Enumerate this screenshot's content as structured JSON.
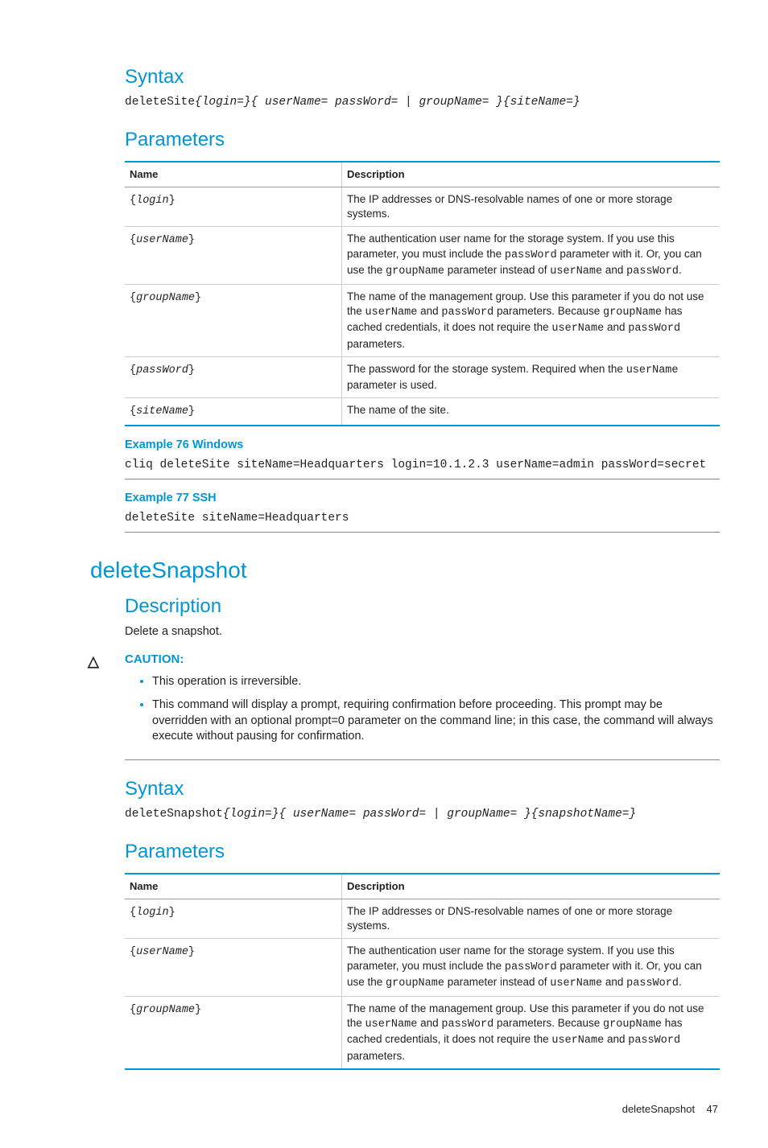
{
  "section1": {
    "syntax_heading": "Syntax",
    "syntax_cmd": "deleteSite",
    "syntax_parts": "{login=}{ userName= passWord= | groupName= }{siteName=}",
    "params_heading": "Parameters",
    "table": {
      "col_name": "Name",
      "col_desc": "Description",
      "rows": [
        {
          "name": "{login}",
          "desc": "The IP addresses or DNS-resolvable names of one or more storage systems."
        },
        {
          "name": "{userName}",
          "desc_pre": "The authentication user name for the storage system. If you use this parameter, you must include the ",
          "c1": "passWord",
          "desc_mid1": " parameter with it. Or, you can use the ",
          "c2": "groupName",
          "desc_mid2": " parameter instead of ",
          "c3": "userName",
          "desc_mid3": " and ",
          "c4": "passWord",
          "desc_post": "."
        },
        {
          "name": "{groupName}",
          "desc_pre": "The name of the management group. Use this parameter if you do not use the ",
          "c1": "userName",
          "desc_mid1": " and ",
          "c2": "passWord",
          "desc_mid2": " parameters. Because ",
          "c3": "groupName",
          "desc_mid3": " has cached credentials, it does not require the ",
          "c4": "userName",
          "desc_mid4": " and ",
          "c5": "passWord",
          "desc_post": " parameters."
        },
        {
          "name": "{passWord}",
          "desc_pre": "The password for the storage system. Required when the ",
          "c1": "userName",
          "desc_post": " parameter is used."
        },
        {
          "name": "{siteName}",
          "desc": "The name of the site."
        }
      ]
    },
    "example1_title": "Example 76 Windows",
    "example1_code": "cliq deleteSite siteName=Headquarters login=10.1.2.3 userName=admin passWord=secret",
    "example2_title": "Example 77 SSH",
    "example2_code": "deleteSite siteName=Headquarters"
  },
  "section2": {
    "cmd_heading": "deleteSnapshot",
    "desc_heading": "Description",
    "desc_text": "Delete a snapshot.",
    "caution_label": "CAUTION:",
    "caution_items": [
      "This operation is irreversible.",
      "This command will display a prompt, requiring confirmation before proceeding. This prompt may be overridden with an optional prompt=0 parameter on the command line; in this case, the command will always execute without pausing for confirmation."
    ],
    "syntax_heading": "Syntax",
    "syntax_cmd": "deleteSnapshot",
    "syntax_parts": "{login=}{ userName= passWord= | groupName= }{snapshotName=}",
    "params_heading": "Parameters",
    "table": {
      "col_name": "Name",
      "col_desc": "Description",
      "rows": [
        {
          "name": "{login}",
          "desc": "The IP addresses or DNS-resolvable names of one or more storage systems."
        },
        {
          "name": "{userName}",
          "desc_pre": "The authentication user name for the storage system. If you use this parameter, you must include the ",
          "c1": "passWord",
          "desc_mid1": " parameter with it. Or, you can use the ",
          "c2": "groupName",
          "desc_mid2": " parameter instead of ",
          "c3": "userName",
          "desc_mid3": " and ",
          "c4": "passWord",
          "desc_post": "."
        },
        {
          "name": "{groupName}",
          "desc_pre": "The name of the management group. Use this parameter if you do not use the ",
          "c1": "userName",
          "desc_mid1": " and ",
          "c2": "passWord",
          "desc_mid2": " parameters. Because ",
          "c3": "groupName",
          "desc_mid3": " has cached credentials, it does not require the ",
          "c4": "userName",
          "desc_mid4": " and ",
          "c5": "passWord",
          "desc_post": " parameters."
        }
      ]
    }
  },
  "footer": {
    "label": "deleteSnapshot",
    "page": "47"
  }
}
